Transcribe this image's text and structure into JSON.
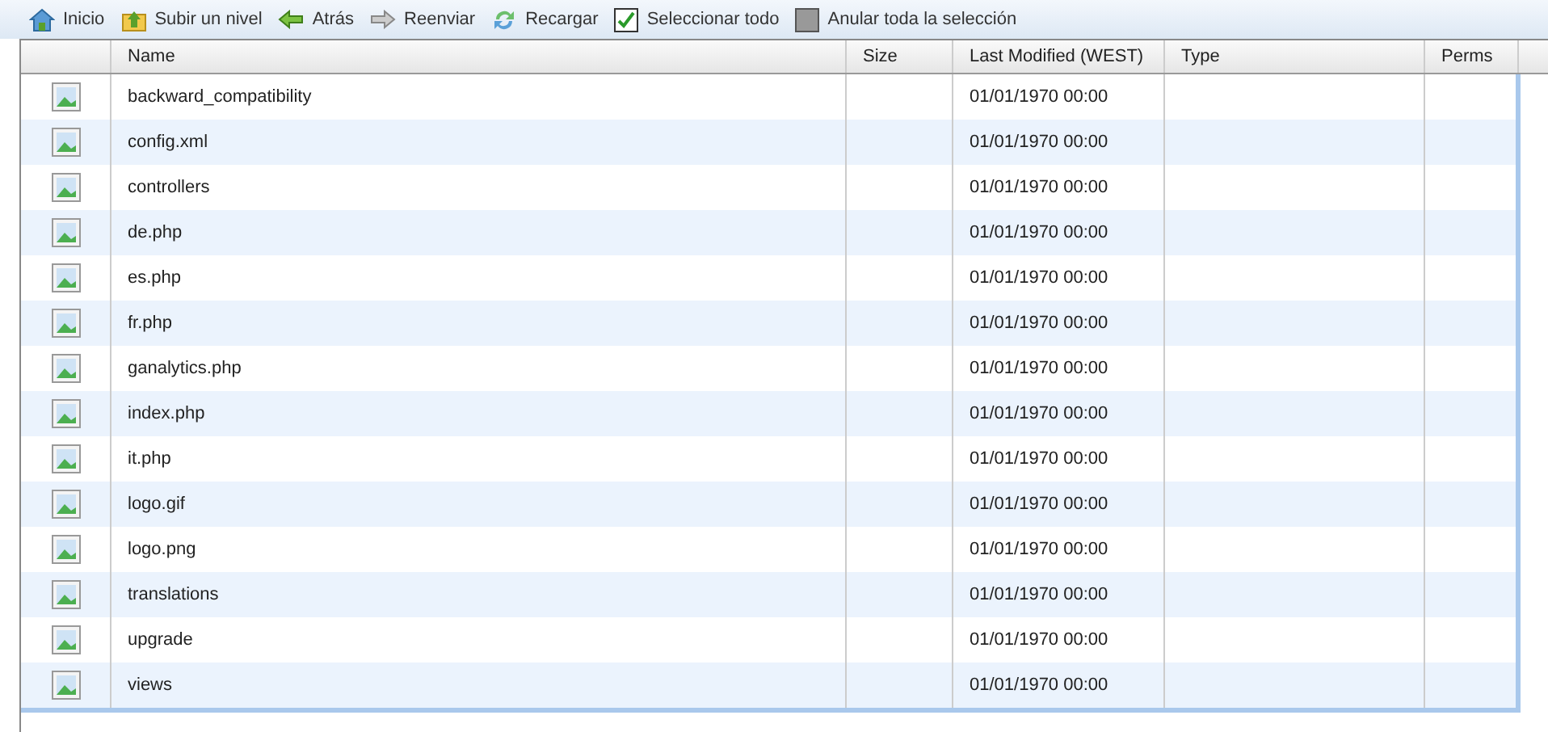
{
  "toolbar": [
    {
      "kind": "home",
      "label": "Inicio"
    },
    {
      "kind": "up",
      "label": "Subir un nivel"
    },
    {
      "kind": "back",
      "label": "Atrás"
    },
    {
      "kind": "forward",
      "label": "Reenviar"
    },
    {
      "kind": "reload",
      "label": "Recargar"
    },
    {
      "kind": "selectall",
      "label": "Seleccionar todo"
    },
    {
      "kind": "deselect",
      "label": "Anular toda la selección"
    }
  ],
  "table": {
    "columns": [
      "Name",
      "Size",
      "Last Modified (WEST)",
      "Type",
      "Perms"
    ],
    "rows": [
      {
        "name": "backward_compatibility",
        "modified": "01/01/1970 00:00"
      },
      {
        "name": "config.xml",
        "modified": "01/01/1970 00:00"
      },
      {
        "name": "controllers",
        "modified": "01/01/1970 00:00"
      },
      {
        "name": "de.php",
        "modified": "01/01/1970 00:00"
      },
      {
        "name": "es.php",
        "modified": "01/01/1970 00:00"
      },
      {
        "name": "fr.php",
        "modified": "01/01/1970 00:00"
      },
      {
        "name": "ganalytics.php",
        "modified": "01/01/1970 00:00"
      },
      {
        "name": "index.php",
        "modified": "01/01/1970 00:00"
      },
      {
        "name": "it.php",
        "modified": "01/01/1970 00:00"
      },
      {
        "name": "logo.gif",
        "modified": "01/01/1970 00:00"
      },
      {
        "name": "logo.png",
        "modified": "01/01/1970 00:00"
      },
      {
        "name": "translations",
        "modified": "01/01/1970 00:00"
      },
      {
        "name": "upgrade",
        "modified": "01/01/1970 00:00"
      },
      {
        "name": "views",
        "modified": "01/01/1970 00:00"
      }
    ]
  }
}
